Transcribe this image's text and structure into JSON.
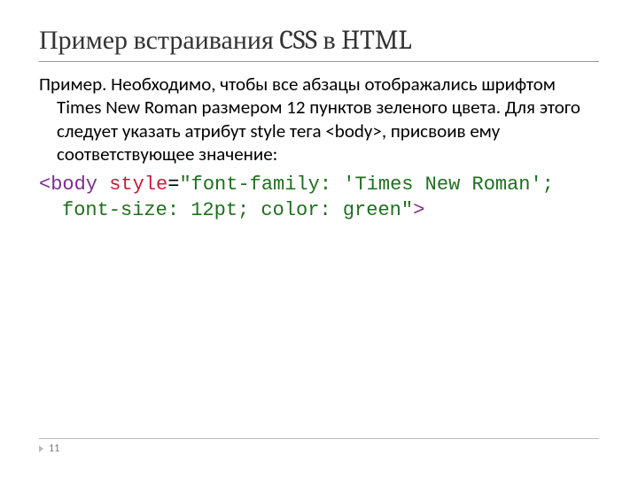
{
  "title": "Пример встраивания CSS в HTML",
  "paragraph": "Пример. Необходимо, чтобы все абзацы отображались шрифтом Times New Roman размером 12 пунктов зеленого цвета. Для этого следует указать атрибут style тега <body>, присвоив ему соответствующее значение:",
  "code": {
    "open": "<body",
    "attr": " style",
    "eq": "=",
    "val": "\"font-family: 'Times New Roman'; font-size: 12pt; color: green\"",
    "close": ">"
  },
  "page": "11"
}
